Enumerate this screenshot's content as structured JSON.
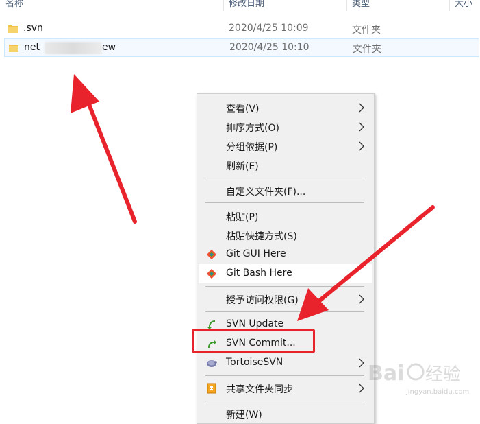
{
  "columns": {
    "name": "名称",
    "date": "修改日期",
    "type": "类型",
    "size": "大小"
  },
  "rows": [
    {
      "name": ".svn",
      "date": "2020/4/25 10:09",
      "type": "文件夹"
    },
    {
      "name_prefix": "net",
      "name_suffix": "ew",
      "date": "2020/4/25 10:10",
      "type": "文件夹"
    }
  ],
  "menu": {
    "view": "查看(V)",
    "sort": "排序方式(O)",
    "group": "分组依据(P)",
    "refresh": "刷新(E)",
    "customize": "自定义文件夹(F)...",
    "paste": "粘贴(P)",
    "paste_shortcut": "粘贴快捷方式(S)",
    "git_gui": "Git GUI Here",
    "git_bash": "Git Bash Here",
    "grant_access": "授予访问权限(G)",
    "svn_update": "SVN Update",
    "svn_commit": "SVN Commit...",
    "tortoise": "TortoiseSVN",
    "share_sync": "共享文件夹同步",
    "new": "新建(W)"
  },
  "icons": {
    "folder": "folder-icon",
    "git": "git-icon",
    "svn_update": "svn-update-icon",
    "svn_commit": "svn-commit-icon",
    "tortoise": "tortoisesvn-icon",
    "share": "share-sync-icon",
    "submenu": "chevron-right-icon"
  },
  "colors": {
    "annotation_red": "#e8232c",
    "hover_bg": "#ffffff",
    "menu_bg": "#f0f0f0"
  },
  "watermark": {
    "text": "jingyan.baidu.com"
  }
}
